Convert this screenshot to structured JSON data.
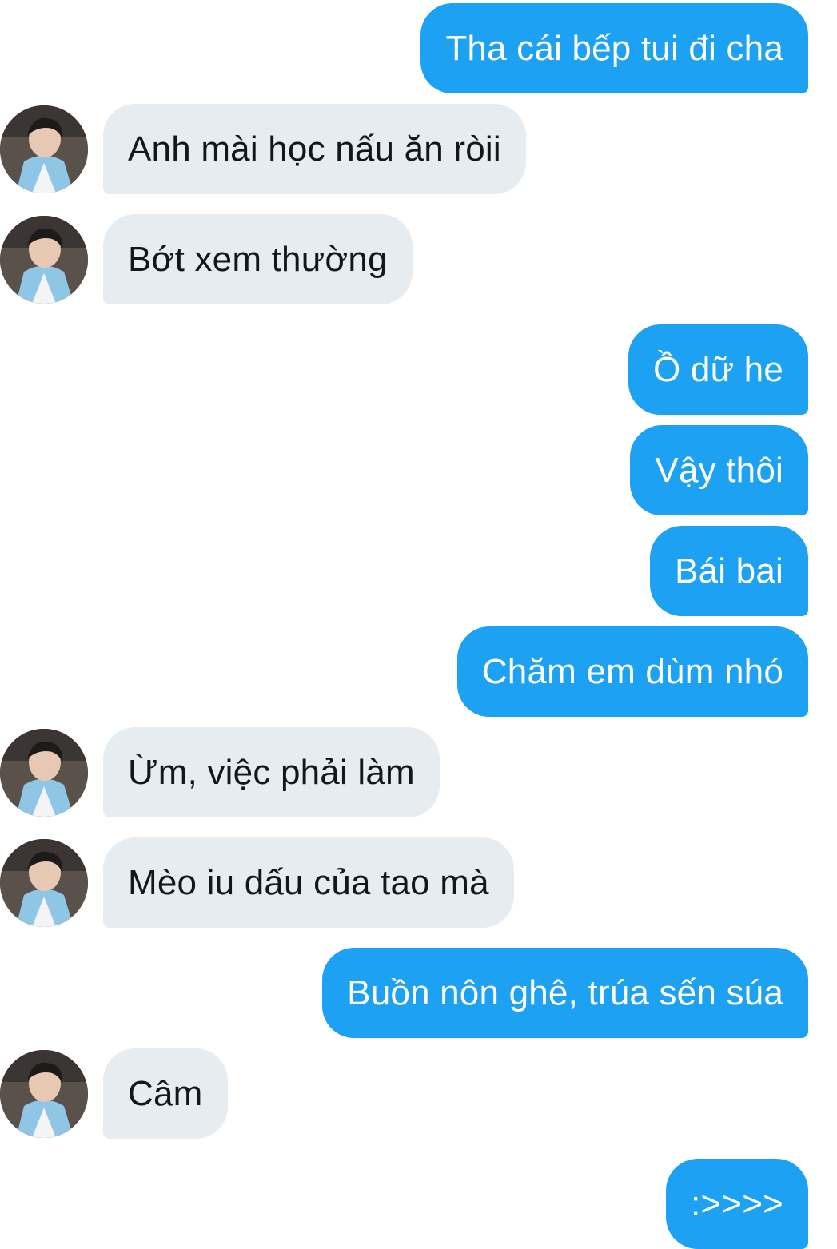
{
  "conversation": {
    "messages": [
      {
        "side": "sent",
        "text": "Tha cái bếp tui đi cha"
      },
      {
        "side": "recv",
        "text": "Anh mài học nấu ăn ròii",
        "avatar": "contact-avatar"
      },
      {
        "side": "recv",
        "text": "Bớt xem thường",
        "avatar": "contact-avatar"
      },
      {
        "side": "sent",
        "text": "Ồ dữ he"
      },
      {
        "side": "sent",
        "text": "Vậy thôi"
      },
      {
        "side": "sent",
        "text": "Bái bai"
      },
      {
        "side": "sent",
        "text": "Chăm em dùm nhó"
      },
      {
        "side": "recv",
        "text": "Ừm, việc phải làm",
        "avatar": "contact-avatar"
      },
      {
        "side": "recv",
        "text": "Mèo iu dấu của tao mà",
        "avatar": "contact-avatar"
      },
      {
        "side": "sent",
        "text": "Buồn nôn ghê, trúa sến súa"
      },
      {
        "side": "recv",
        "text": "Câm",
        "avatar": "contact-avatar"
      },
      {
        "side": "sent",
        "text": ":>>>>"
      }
    ]
  },
  "colors": {
    "sent_bubble": "#1da1f2",
    "received_bubble": "#e6ecf0",
    "sent_text": "#ffffff",
    "received_text": "#14171a",
    "background": "#ffffff"
  }
}
